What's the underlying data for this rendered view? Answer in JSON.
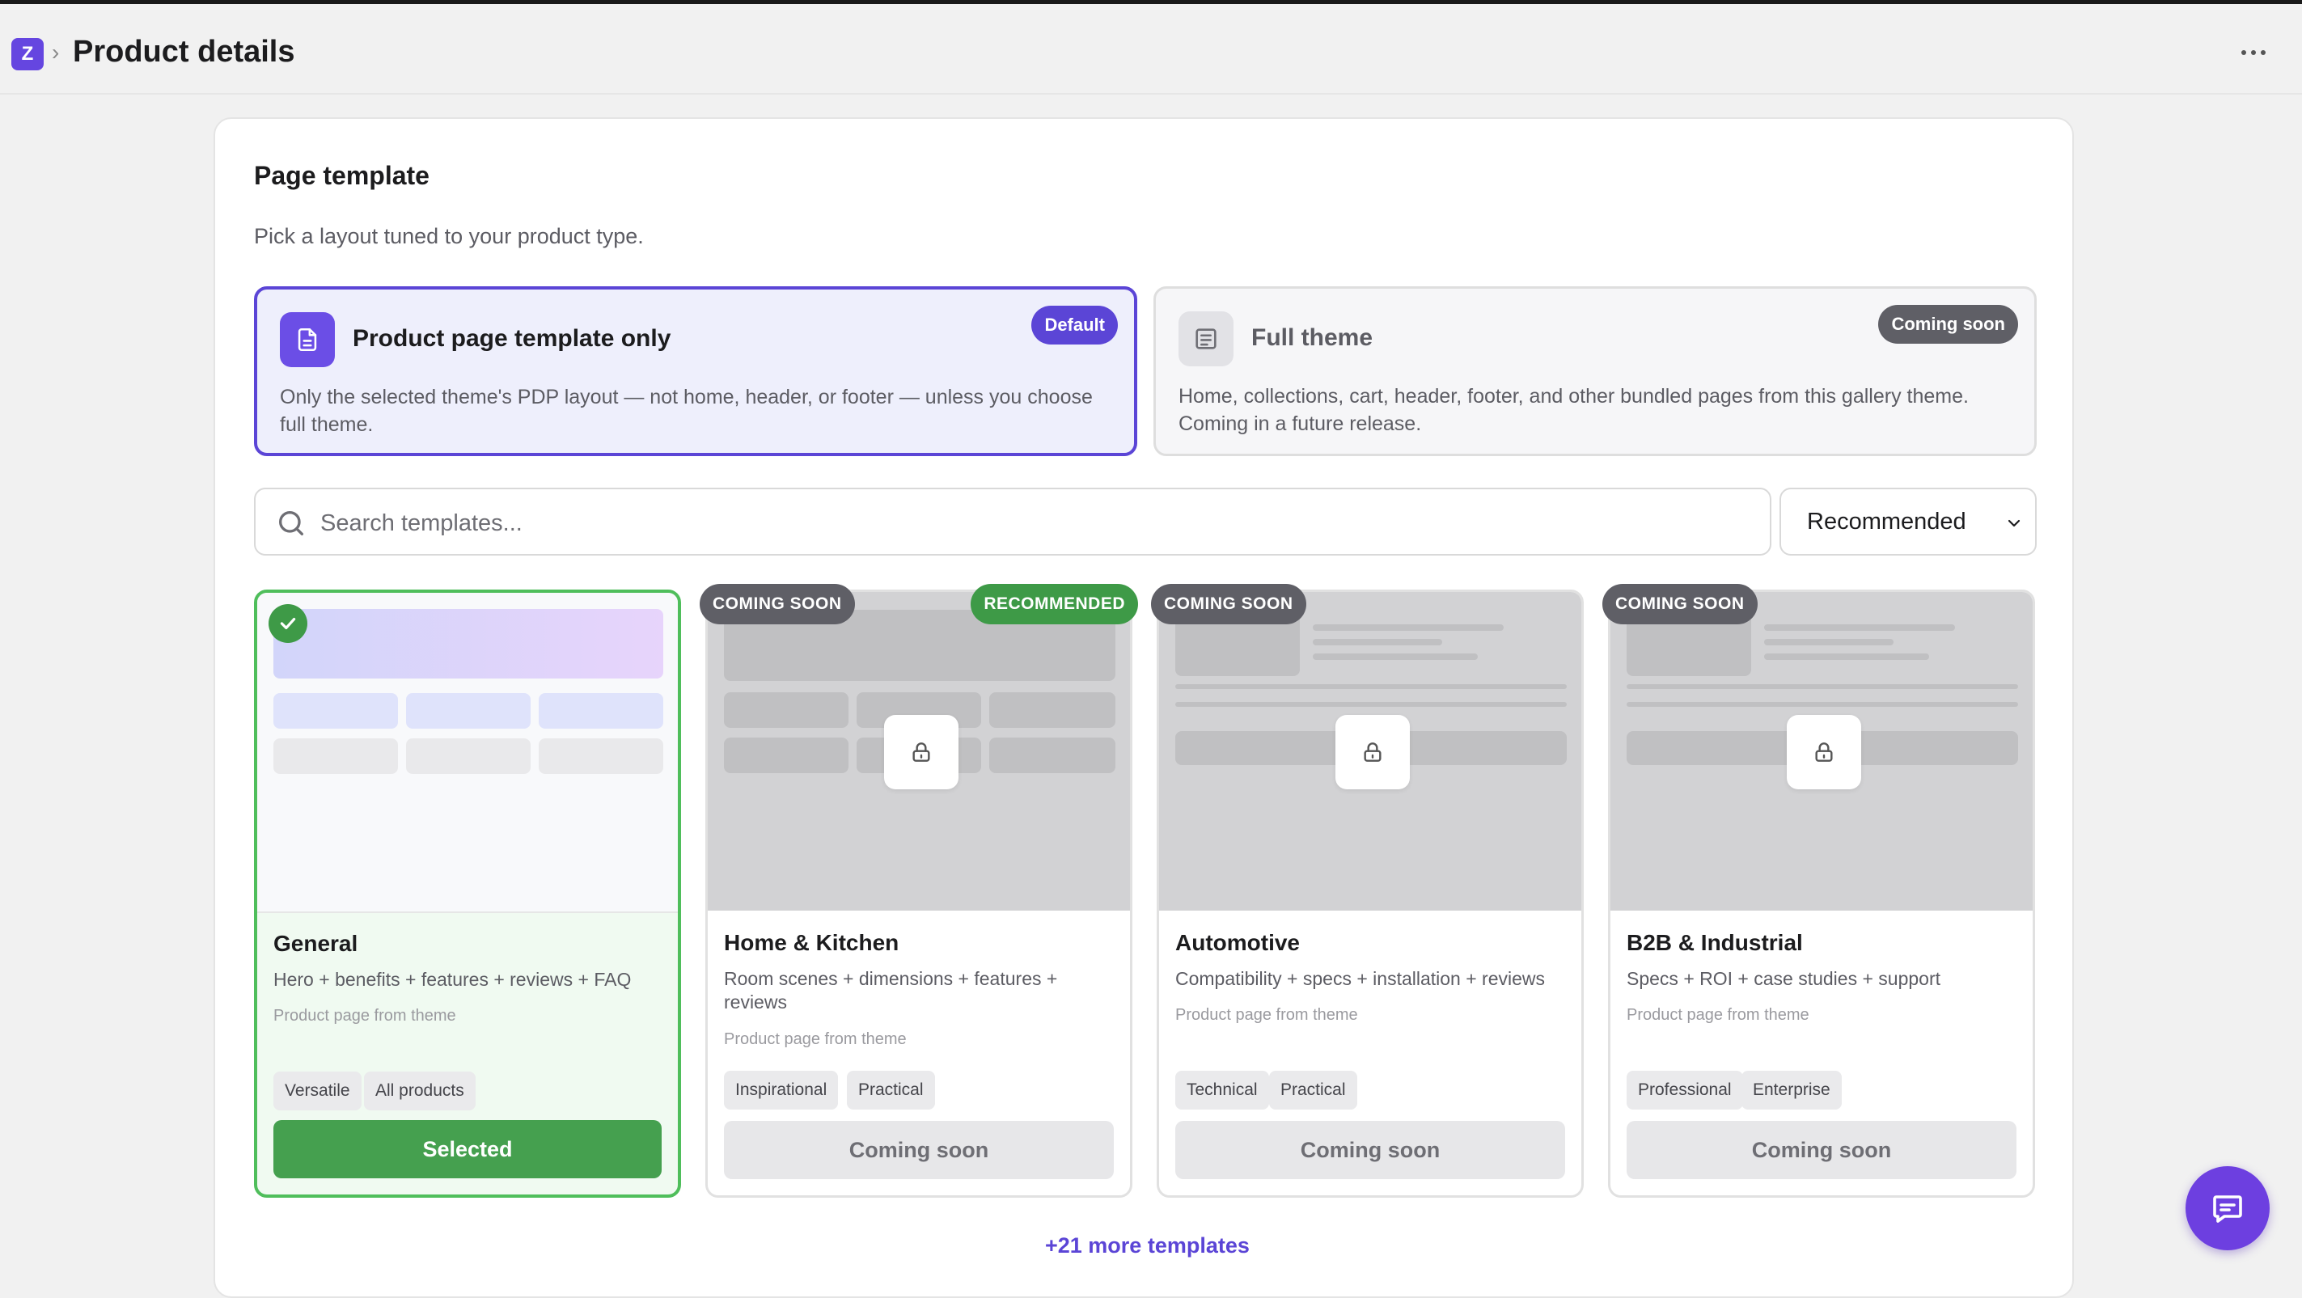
{
  "header": {
    "logo_letter": "Z",
    "separator": "›",
    "title": "Product details"
  },
  "panel": {
    "title": "Page template",
    "subtitle": "Pick a layout tuned to your product type."
  },
  "options": [
    {
      "title": "Product page template only",
      "description": "Only the selected theme's PDP layout — not home, header, or footer — unless you choose full theme.",
      "badge": "Default",
      "selected": true,
      "icon": "document-icon"
    },
    {
      "title": "Full theme",
      "description": "Home, collections, cart, header, footer, and other bundled pages from this gallery theme. Coming in a future release.",
      "badge": "Coming soon",
      "selected": false,
      "icon": "layout-icon"
    }
  ],
  "search": {
    "placeholder": "Search templates..."
  },
  "sort": {
    "value": "Recommended"
  },
  "templates": [
    {
      "title": "General",
      "description": "Hero + benefits + features + reviews + FAQ",
      "source": "Product page from theme",
      "tags": [
        "Versatile",
        "All products"
      ],
      "button": "Selected",
      "selected": true
    },
    {
      "title": "Home & Kitchen",
      "description": "Room scenes + dimensions + features + reviews",
      "source": "Product page from theme",
      "tags": [
        "Inspirational",
        "Practical"
      ],
      "button": "Coming soon",
      "badge_left": "COMING SOON",
      "badge_right": "RECOMMENDED"
    },
    {
      "title": "Automotive",
      "description": "Compatibility + specs + installation + reviews",
      "source": "Product page from theme",
      "tags": [
        "Technical",
        "Practical"
      ],
      "button": "Coming soon",
      "badge_left": "COMING SOON"
    },
    {
      "title": "B2B & Industrial",
      "description": "Specs + ROI + case studies + support",
      "source": "Product page from theme",
      "tags": [
        "Professional",
        "Enterprise"
      ],
      "button": "Coming soon",
      "badge_left": "COMING SOON"
    }
  ],
  "more_templates": "+21 more templates",
  "colors": {
    "accent": "#5b45d6",
    "selected_green": "#45a04f",
    "badge_gray": "#5f5f66"
  }
}
